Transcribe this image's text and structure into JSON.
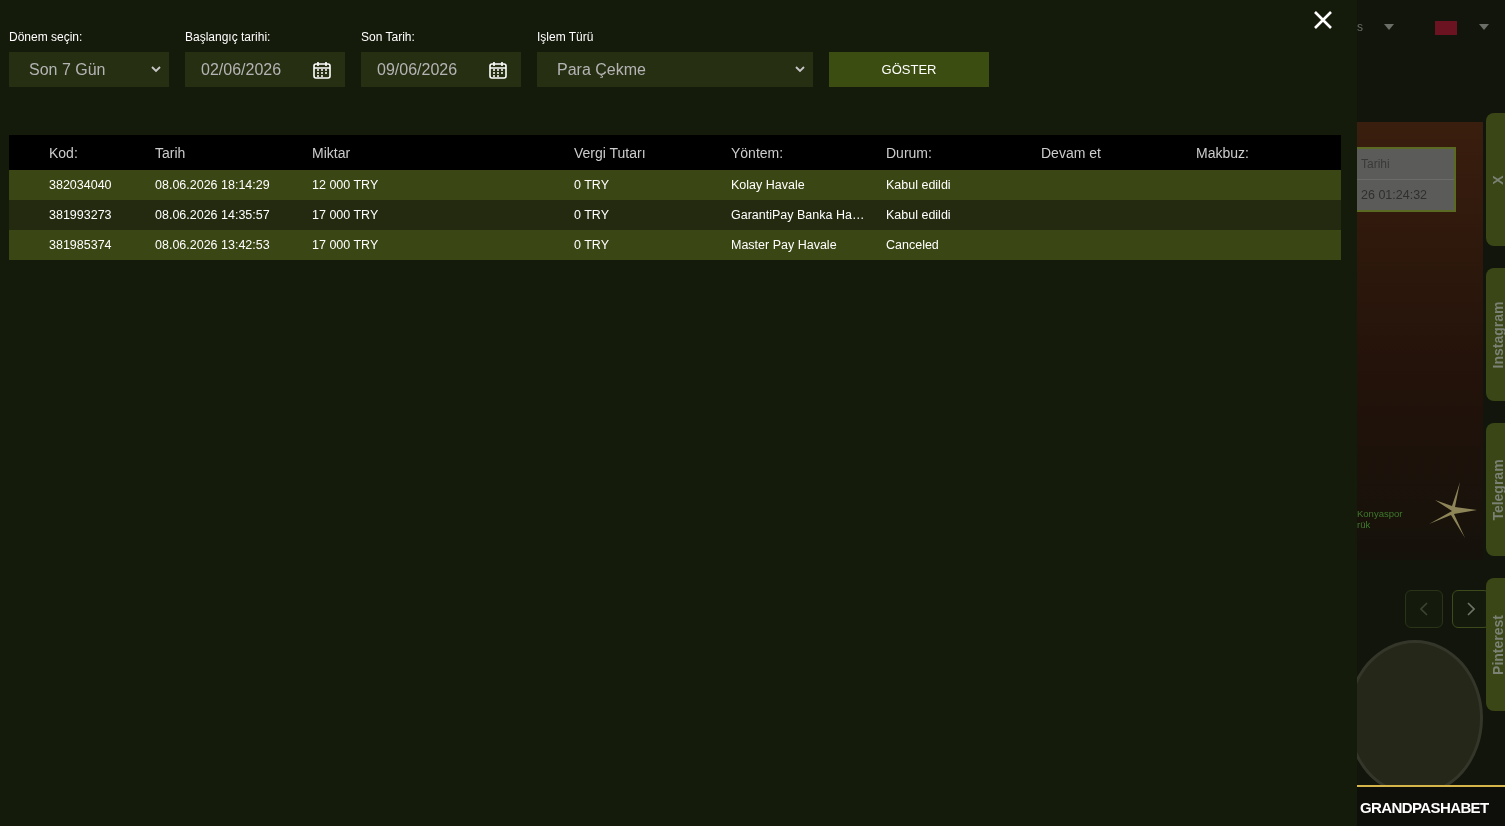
{
  "filters": [
    {
      "kind": "select",
      "label": "Dönem seçin:",
      "value": "Son 7 Gün"
    },
    {
      "kind": "date",
      "label": "Başlangıç tarihi:",
      "value": "02/06/2026"
    },
    {
      "kind": "date",
      "label": "Son Tarih:",
      "value": "09/06/2026"
    },
    {
      "kind": "select",
      "label": "Işlem Türü",
      "value": "Para Çekme"
    }
  ],
  "show_button": "GÖSTER",
  "table": {
    "columns": [
      "Kod:",
      "Tarih",
      "Miktar",
      "Vergi Tutarı",
      "Yöntem:",
      "Durum:",
      "Devam et",
      "Makbuz:"
    ],
    "rows": [
      {
        "code": "382034040",
        "date": "08.06.2026 18:14:29",
        "amount": "12 000 TRY",
        "tax": "0 TRY",
        "method": "Kolay Havale",
        "status": "Kabul edildi"
      },
      {
        "code": "381993273",
        "date": "08.06.2026 14:35:57",
        "amount": "17 000 TRY",
        "tax": "0 TRY",
        "method": "GarantiPay Banka Ha…",
        "status": "Kabul edildi"
      },
      {
        "code": "381985374",
        "date": "08.06.2026 13:42:53",
        "amount": "17 000 TRY",
        "tax": "0 TRY",
        "method": "Master Pay Havale",
        "status": "Canceled"
      }
    ]
  },
  "background_page": {
    "header_select": "s",
    "banner_box": {
      "label": "Tarihi",
      "value": "26 01:24:32"
    },
    "match_lines": [
      "Konyaspor",
      "rük"
    ],
    "social_tabs": [
      "X",
      "Instagram",
      "Telegram",
      "Pinterest"
    ],
    "support_button": "GRANDPASHABET"
  }
}
